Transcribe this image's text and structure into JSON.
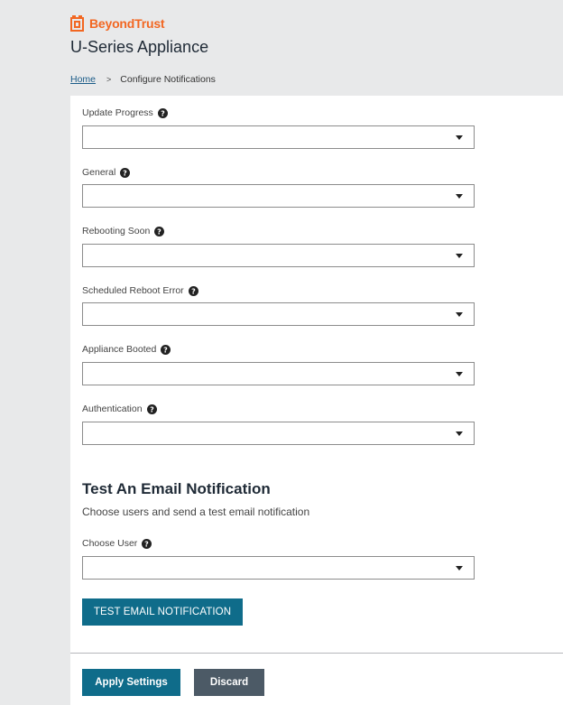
{
  "brand": {
    "name": "BeyondTrust",
    "accent_color": "#f26722"
  },
  "app": {
    "title": "U-Series Appliance"
  },
  "breadcrumb": {
    "home": "Home",
    "separator": ">",
    "current": "Configure Notifications"
  },
  "fields": [
    {
      "label": "Update Progress",
      "value": ""
    },
    {
      "label": "General",
      "value": ""
    },
    {
      "label": "Rebooting Soon",
      "value": ""
    },
    {
      "label": "Scheduled Reboot Error",
      "value": ""
    },
    {
      "label": "Appliance Booted",
      "value": ""
    },
    {
      "label": "Authentication",
      "value": ""
    }
  ],
  "test_section": {
    "title": "Test An Email Notification",
    "subtitle": "Choose users and send a test email notification",
    "choose_user_label": "Choose User",
    "choose_user_value": "",
    "test_button": "TEST EMAIL NOTIFICATION"
  },
  "footer": {
    "apply_label": "Apply Settings",
    "discard_label": "Discard"
  },
  "colors": {
    "primary_button": "#0f6c8a",
    "secondary_button": "#4c5a66",
    "link": "#1b5c88"
  }
}
